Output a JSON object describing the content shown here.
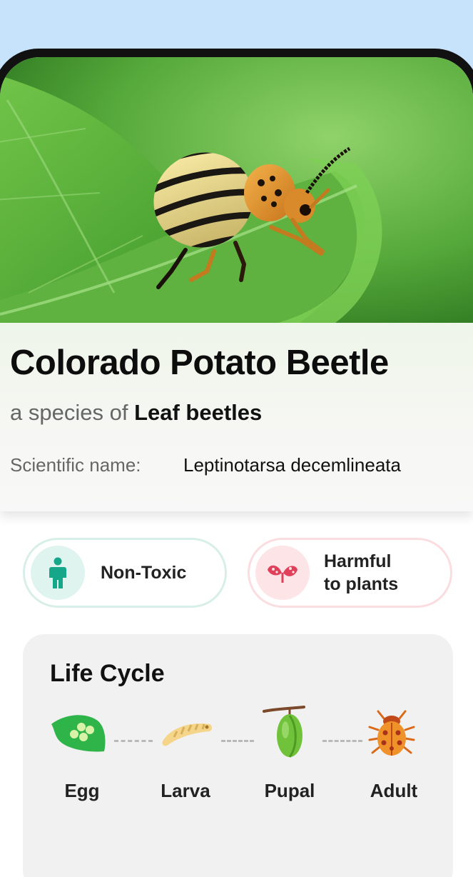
{
  "header": {
    "title": "Colorado Potato Beetle",
    "subtitle_prefix": "a species of",
    "subtitle_group": "Leaf beetles",
    "scientific_label": "Scientific name:",
    "scientific_value": "Leptinotarsa decemlineata"
  },
  "badges": [
    {
      "label": "Non-Toxic",
      "icon": "person-icon",
      "color": "#16a68a"
    },
    {
      "line1": "Harmful",
      "line2": "to plants",
      "icon": "harmful-leaf-icon",
      "color": "#e0405a"
    }
  ],
  "life_cycle": {
    "title": "Life Cycle",
    "stages": [
      {
        "label": "Egg",
        "icon": "egg-leaf-icon"
      },
      {
        "label": "Larva",
        "icon": "larva-icon"
      },
      {
        "label": "Pupal",
        "icon": "pupa-icon"
      },
      {
        "label": "Adult",
        "icon": "beetle-icon"
      }
    ]
  },
  "colors": {
    "background": "#c6e3fb",
    "phone_frame": "#111111",
    "leaf_green": "#5cb83a",
    "beetle_orange": "#e8932a"
  }
}
